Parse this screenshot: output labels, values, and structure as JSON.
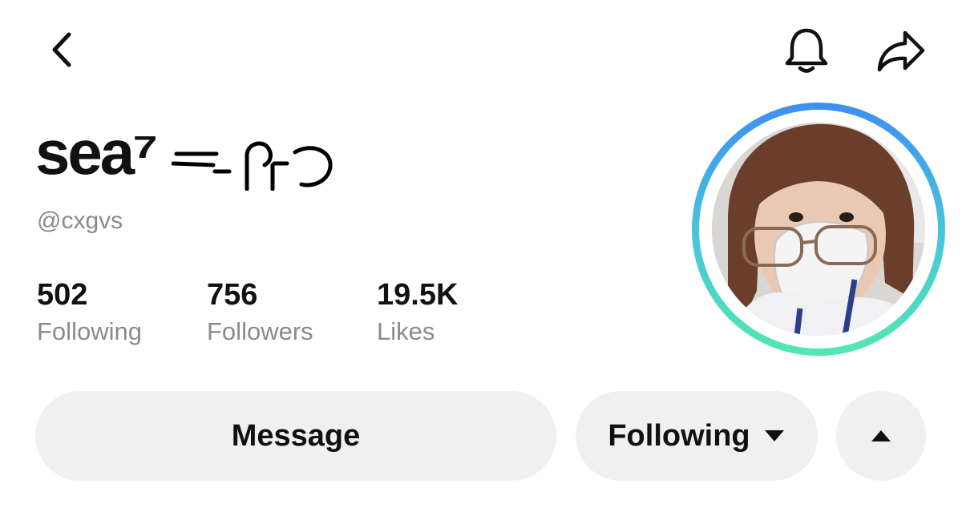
{
  "header": {
    "back_icon": "chevron-left-icon",
    "bell_icon": "bell-icon",
    "share_icon": "share-arrow-icon"
  },
  "profile": {
    "display_name": "sea⁷",
    "display_name_suffix_icon": "handwritten-scribble",
    "handle": "@cxgvs",
    "avatar_ring_colors": [
      "#3d8ff0",
      "#52e8b0"
    ]
  },
  "stats": [
    {
      "value": "502",
      "label": "Following"
    },
    {
      "value": "756",
      "label": "Followers"
    },
    {
      "value": "19.5K",
      "label": "Likes"
    }
  ],
  "actions": {
    "message_label": "Message",
    "following_label": "Following",
    "following_dropdown_icon": "caret-down-icon",
    "more_icon": "caret-up-icon",
    "button_bg": "#f0f0f0"
  }
}
